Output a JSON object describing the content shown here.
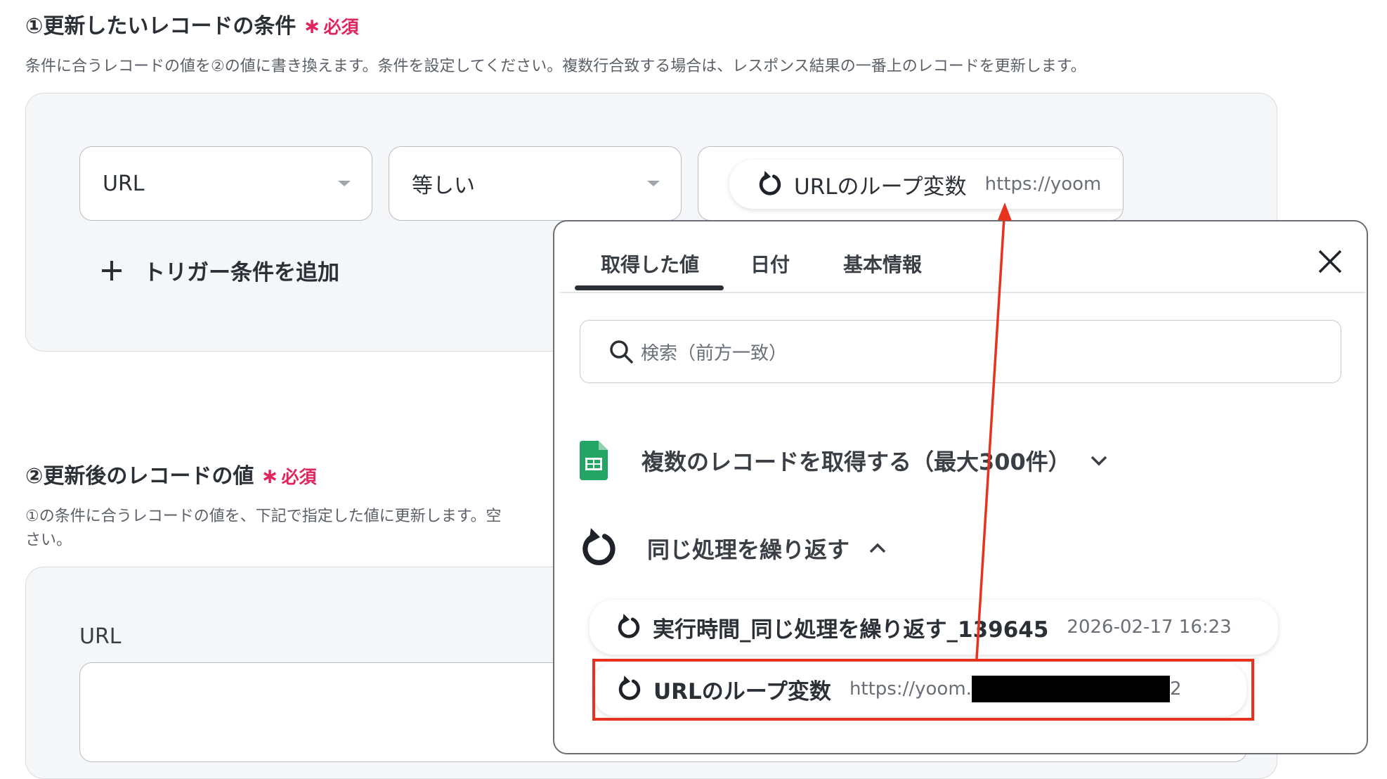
{
  "section1": {
    "title": "①更新したいレコードの条件",
    "required": "必須",
    "description": "条件に合うレコードの値を②の値に書き換えます。条件を設定してください。複数行合致する場合は、レスポンス結果の一番上のレコードを更新します。",
    "field_select": "URL",
    "operator_select": "等しい",
    "value_chip": {
      "label": "URLのループ変数",
      "value": "https://yoom"
    },
    "add_condition": "トリガー条件を追加"
  },
  "section2": {
    "title": "②更新後のレコードの値",
    "required": "必須",
    "description_line1": "①の条件に合うレコードの値を、下記で指定した値に更新します。空",
    "description_line2": "さい。",
    "field_label": "URL"
  },
  "dropdown": {
    "tabs": [
      "取得した値",
      "日付",
      "基本情報"
    ],
    "active_tab": 0,
    "search_placeholder": "検索（前方一致）",
    "groups": [
      {
        "label": "複数のレコードを取得する（最大300件）",
        "icon": "google-sheets-icon",
        "expanded": false
      },
      {
        "label": "同じ処理を繰り返す",
        "icon": "loop-icon",
        "expanded": true
      }
    ],
    "items": [
      {
        "label": "実行時間_同じ処理を繰り返す_139645",
        "value": "2026-02-17 16:23"
      },
      {
        "label": "URLのループ変数",
        "value": "https://yoom.",
        "value_tail": "2"
      }
    ]
  },
  "colors": {
    "required": "#e0245e",
    "annotation": "#e8321e",
    "sheets_green": "#23a566",
    "redaction": "#000000"
  }
}
